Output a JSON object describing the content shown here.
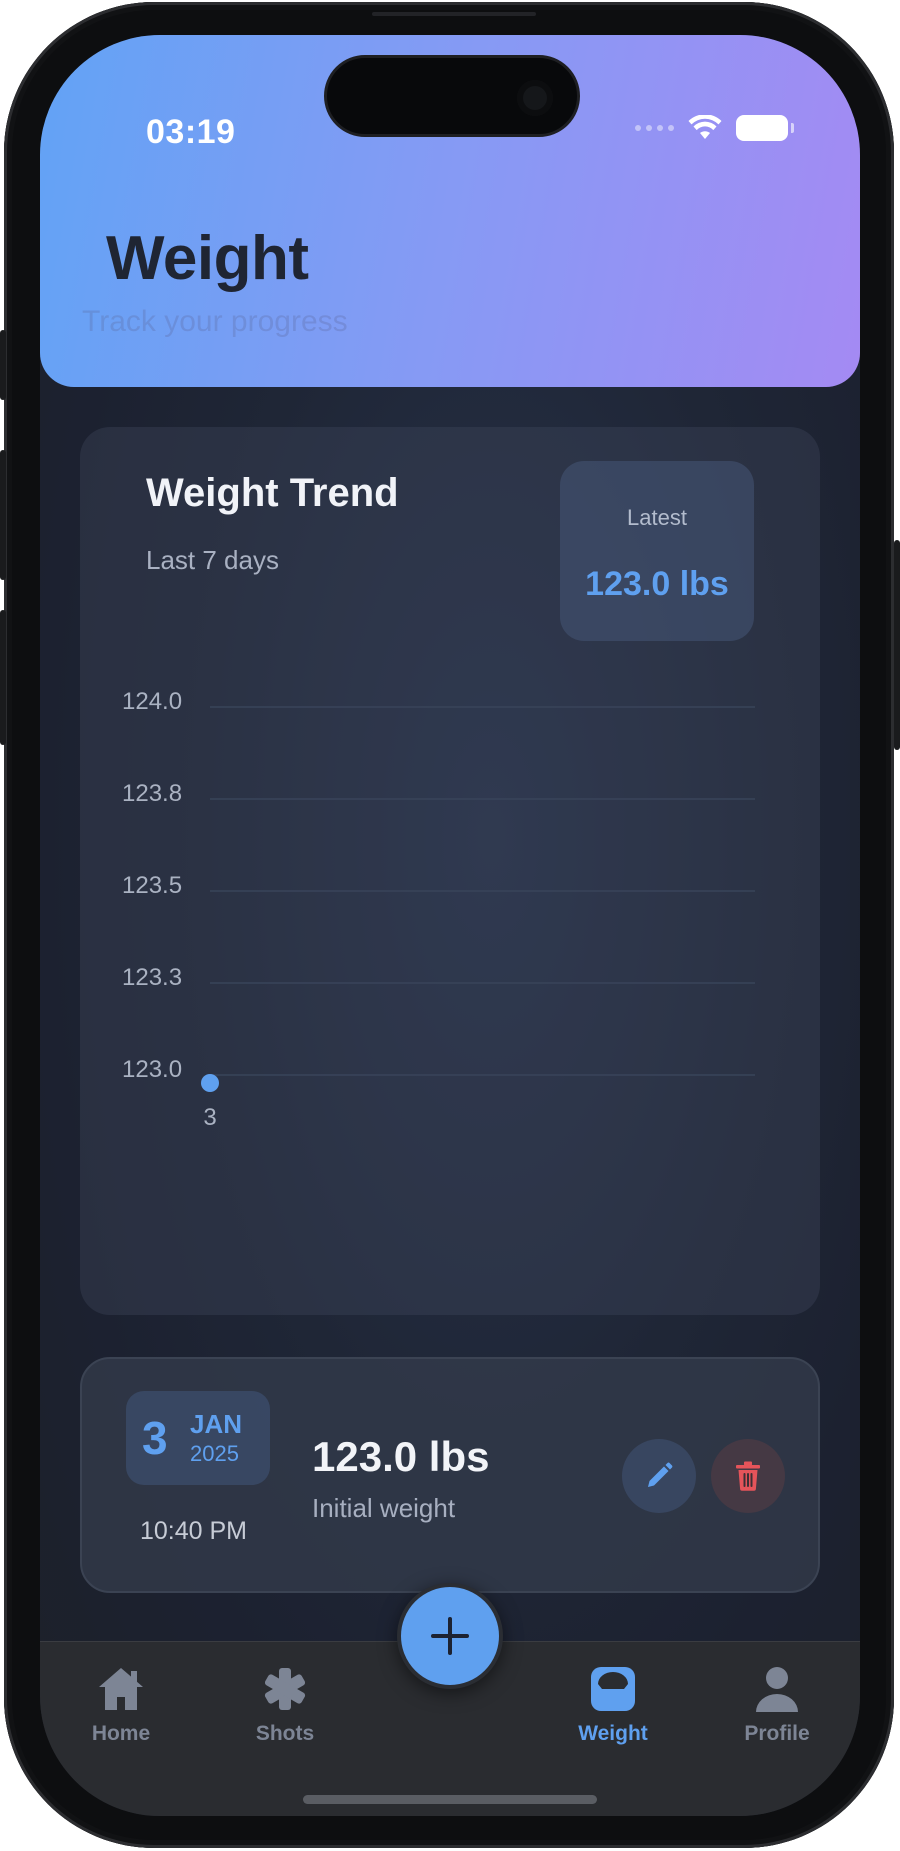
{
  "status_bar": {
    "time": "03:19"
  },
  "header": {
    "title": "Weight",
    "subtitle": "Track your progress"
  },
  "trend": {
    "title": "Weight Trend",
    "subtitle": "Last 7 days",
    "latest_label": "Latest",
    "latest_value": "123.0 lbs"
  },
  "chart_data": {
    "type": "line",
    "x": [
      "3"
    ],
    "series": [
      {
        "values": [
          123.0
        ]
      }
    ],
    "y_ticks": [
      "124.0",
      "123.8",
      "123.5",
      "123.3",
      "123.0"
    ],
    "ylim": [
      123.0,
      124.0
    ],
    "grid": true,
    "colors": {
      "point": "#5fa0ef",
      "grid": "#39445a",
      "tick": "#aab2c2"
    }
  },
  "entry": {
    "day": "3",
    "month": "JAN",
    "year": "2025",
    "time": "10:40 PM",
    "weight": "123.0 lbs",
    "note": "Initial weight"
  },
  "nav": {
    "items": [
      {
        "label": "Home",
        "icon": "home-icon"
      },
      {
        "label": "Shots",
        "icon": "asterisk-icon"
      },
      {
        "label": "Weight",
        "icon": "scale-icon",
        "active": true
      },
      {
        "label": "Profile",
        "icon": "person-icon"
      }
    ],
    "fab_icon": "plus-icon"
  },
  "colors": {
    "accent": "#5fa0ef",
    "danger": "#e5545a"
  }
}
